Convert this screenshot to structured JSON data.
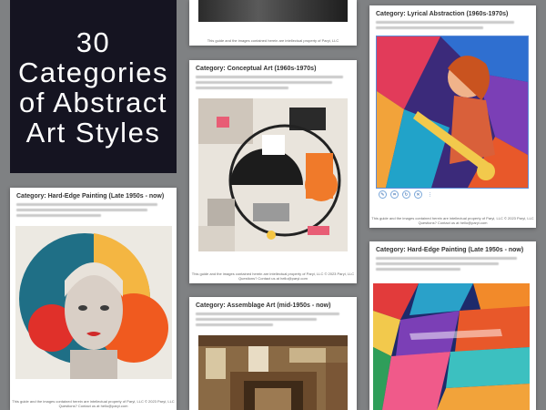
{
  "hero": {
    "line1": "30",
    "line2": "Categories",
    "line3": "of Abstract",
    "line4": "Art Styles"
  },
  "pages": {
    "top": {
      "footer1": "This guide and the images contained herein are intellectual property of Paryi, LLC"
    },
    "conceptual": {
      "category": "Category: Conceptual Art (1960s-1970s)",
      "footer1": "This guide and the images contained herein are intellectual property of Paryi, LLC © 2023 Paryi, LLC",
      "footer2": "Questions? Contact us at hello@paryi.com"
    },
    "lyrical": {
      "category": "Category: Lyrical Abstraction (1960s-1970s)",
      "footer1": "This guide and the images contained herein are intellectual property of Paryi, LLC © 2023 Paryi, LLC",
      "footer2": "Questions? Contact us at hello@paryi.com"
    },
    "hardedge_left": {
      "category": "Category: Hard-Edge Painting (Late 1950s - now)",
      "footer1": "This guide and the images contained herein are intellectual property of Paryi, LLC © 2023 Paryi, LLC",
      "footer2": "Questions? Contact us at hello@paryi.com"
    },
    "assemblage": {
      "category": "Category: Assemblage Art (mid-1950s - now)"
    },
    "hardedge_right": {
      "category": "Category: Hard-Edge Painting (Late 1950s - now)"
    }
  },
  "toolbar_icons": [
    "edit-icon",
    "crop-icon",
    "rotate-icon",
    "delete-icon",
    "more-icon"
  ],
  "colors": {
    "background": "#7f8183",
    "hero_bg": "#151421",
    "page": "#ffffff"
  }
}
